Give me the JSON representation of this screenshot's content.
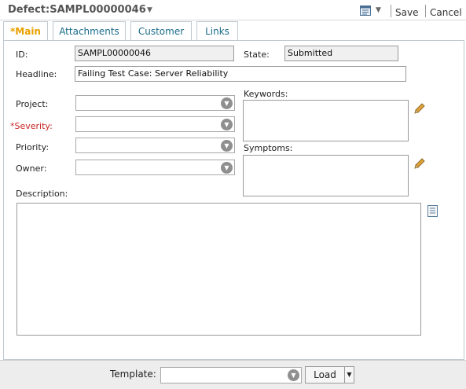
{
  "header": {
    "title": "Defect:SAMPL00000046",
    "save_label": "Save",
    "cancel_label": "Cancel"
  },
  "tabs": [
    {
      "label": "*Main",
      "active": true
    },
    {
      "label": "Attachments",
      "active": false
    },
    {
      "label": "Customer",
      "active": false
    },
    {
      "label": "Links",
      "active": false
    }
  ],
  "form": {
    "id_label": "ID:",
    "id_value": "SAMPL00000046",
    "state_label": "State:",
    "state_value": "Submitted",
    "headline_label": "Headline:",
    "headline_value": "Failing Test Case: Server Reliability",
    "project_label": "Project:",
    "project_value": "",
    "severity_label": "*Severity:",
    "severity_value": "",
    "priority_label": "Priority:",
    "priority_value": "",
    "owner_label": "Owner:",
    "owner_value": "",
    "keywords_label": "Keywords:",
    "symptoms_label": "Symptoms:",
    "description_label": "Description:",
    "description_value": ""
  },
  "footer": {
    "template_label": "Template:",
    "template_value": "",
    "load_label": "Load"
  },
  "colors": {
    "active_tab": "#e8a000",
    "tab_text": "#1a6b8a",
    "required_label": "#cc2222"
  },
  "icons": [
    "chevron-down-icon",
    "form-view-icon",
    "pencil-icon",
    "document-icon"
  ]
}
